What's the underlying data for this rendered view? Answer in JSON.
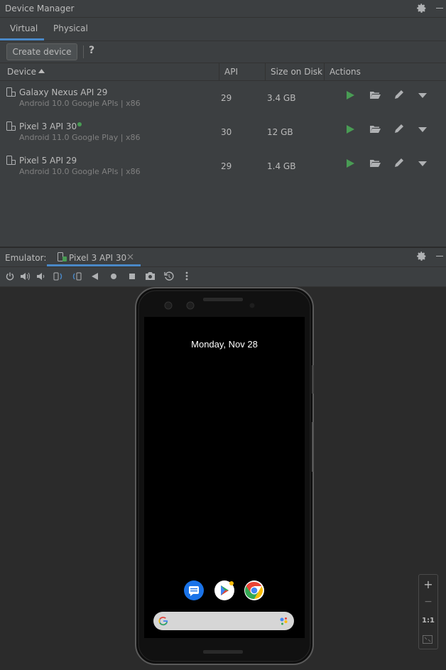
{
  "window": {
    "title": "Device Manager"
  },
  "tabs": [
    {
      "label": "Virtual"
    },
    {
      "label": "Physical"
    }
  ],
  "toolbar": {
    "create_label": "Create device",
    "help_label": "?"
  },
  "table": {
    "columns": [
      "Device",
      "API",
      "Size on Disk",
      "Actions"
    ],
    "rows": [
      {
        "name": "Galaxy Nexus API 29",
        "sub": "Android 10.0 Google APIs | x86",
        "api": "29",
        "size": "3.4 GB",
        "online": false
      },
      {
        "name": "Pixel 3 API 30",
        "sub": "Android 11.0 Google Play | x86",
        "api": "30",
        "size": "12 GB",
        "online": true
      },
      {
        "name": "Pixel 5 API 29",
        "sub": "Android 10.0 Google APIs | x86",
        "api": "29",
        "size": "1.4 GB",
        "online": false
      }
    ]
  },
  "emulator": {
    "label": "Emulator:",
    "tab_label": "Pixel 3 API 30",
    "date_text": "Monday, Nov 28",
    "zoom_ratio": "1:1",
    "zoom_in": "+",
    "zoom_out": "−"
  },
  "colors": {
    "accent": "#4a88c7",
    "run_green": "#499c54",
    "background": "#3c3f41"
  }
}
